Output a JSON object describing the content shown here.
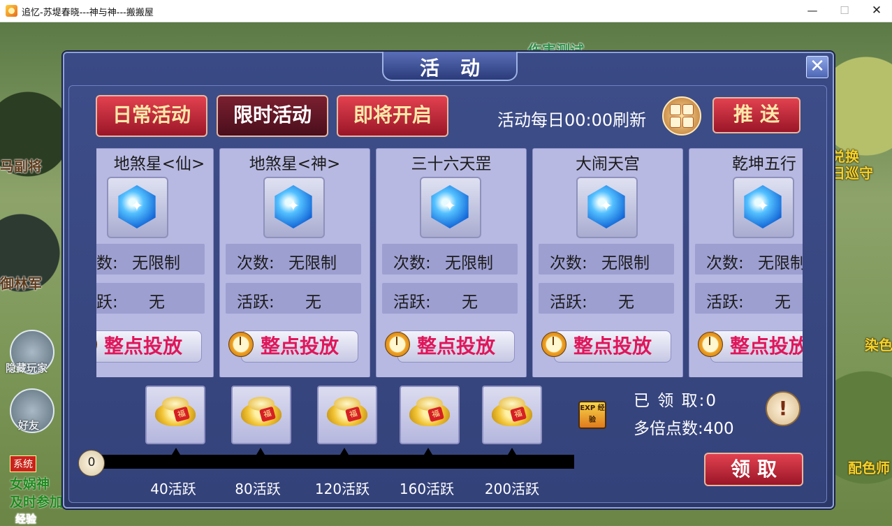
{
  "window": {
    "title": "追忆-苏堤春晓---神与神---搬搬屋",
    "minimize": "—",
    "maximize": "☐",
    "close": "✕"
  },
  "background": {
    "labels": {
      "damage_test": "伤害测试",
      "ma_fu_jiang": "马副将",
      "yu_lin_jun": "御林军",
      "hide_players": "隐藏玩家",
      "friends": "好友",
      "system": "系统",
      "nuwa": "女娲神",
      "join_soon": "及时参加",
      "exchange_patrol_1": "兑换",
      "exchange_patrol_2": "日巡守",
      "dye": "染色",
      "color_master": "配色师",
      "exp_bar": "经验"
    }
  },
  "dialog": {
    "title": "活动",
    "close_icon": "✕",
    "tabs": [
      {
        "label": "日常活动",
        "active": false
      },
      {
        "label": "限时活动",
        "active": true
      },
      {
        "label": "即将开启",
        "active": false
      }
    ],
    "refresh_text": "活动每日00:00刷新",
    "push_label": "推送",
    "count_label": "次数:",
    "active_label": "活跃:",
    "cards": [
      {
        "name": "地煞星<仙>",
        "count": "无限制",
        "active": "无",
        "button": "整点投放",
        "icon": "blue-gem-icon"
      },
      {
        "name": "地煞星<神>",
        "count": "无限制",
        "active": "无",
        "button": "整点投放",
        "icon": "blue-gem-icon"
      },
      {
        "name": "三十六天罡",
        "count": "无限制",
        "active": "无",
        "button": "整点投放",
        "icon": "blue-gem-icon"
      },
      {
        "name": "大闹天宫",
        "count": "无限制",
        "active": "无",
        "button": "整点投放",
        "icon": "blue-gem-icon"
      },
      {
        "name": "乾坤五行",
        "count": "无限制",
        "active": "无",
        "button": "整点投放",
        "icon": "blue-gem-icon"
      }
    ],
    "rewards": [
      {
        "milestone": "40活跃",
        "icon": "gold-ingot-icon",
        "tag": "福"
      },
      {
        "milestone": "80活跃",
        "icon": "gold-ingot-icon",
        "tag": "福"
      },
      {
        "milestone": "120活跃",
        "icon": "gold-ingot-icon",
        "tag": "福"
      },
      {
        "milestone": "160活跃",
        "icon": "gold-ingot-icon",
        "tag": "福"
      },
      {
        "milestone": "200活跃",
        "icon": "gold-ingot-icon",
        "tag": "福"
      }
    ],
    "progress": {
      "current": "0",
      "max": 200
    },
    "exp_icon_text": "EXP 经验",
    "claimed_text": "已 领 取:0",
    "multiplier_text": "多倍点数:400",
    "help_icon": "!",
    "claim_label": "领取"
  }
}
